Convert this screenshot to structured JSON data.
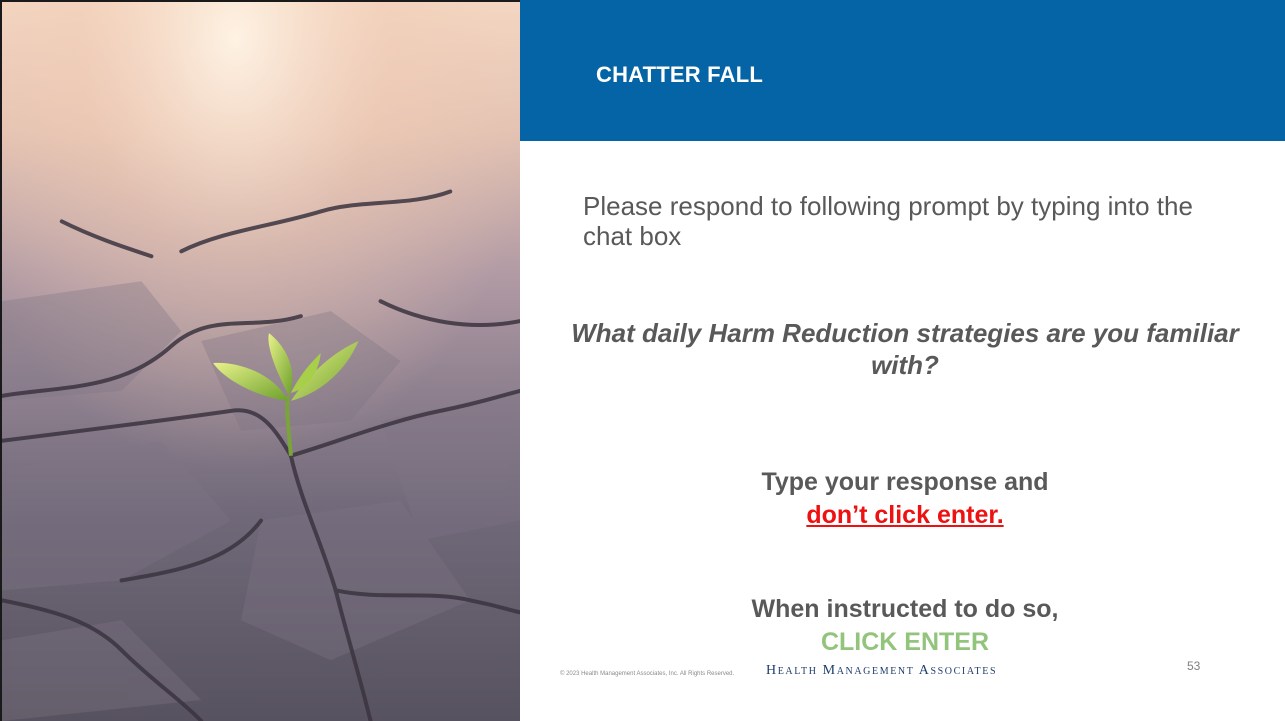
{
  "slide": {
    "title": "CHATTER FALL",
    "intro_text": "Please respond to following prompt by typing into the chat box",
    "question": "What daily Harm Reduction strategies are you familiar with?",
    "instruction_line1": "Type your response and",
    "instruction_warning": "don’t click enter.",
    "instruction_line2": "When instructed to do so,",
    "instruction_action": "CLICK ENTER",
    "footer": {
      "copyright": "© 2023 Health Management Associates, Inc. All Rights Reserved.",
      "brand": "Health Management Associates",
      "page_number": "53"
    }
  },
  "colors": {
    "header_bar": "#0564a6",
    "body_text": "#595959",
    "warning_red": "#ee1111",
    "action_green": "#92c47c",
    "brand_navy": "#1f3d6b"
  },
  "image": {
    "description_icon": "cracked-earth-sprout-photo"
  }
}
